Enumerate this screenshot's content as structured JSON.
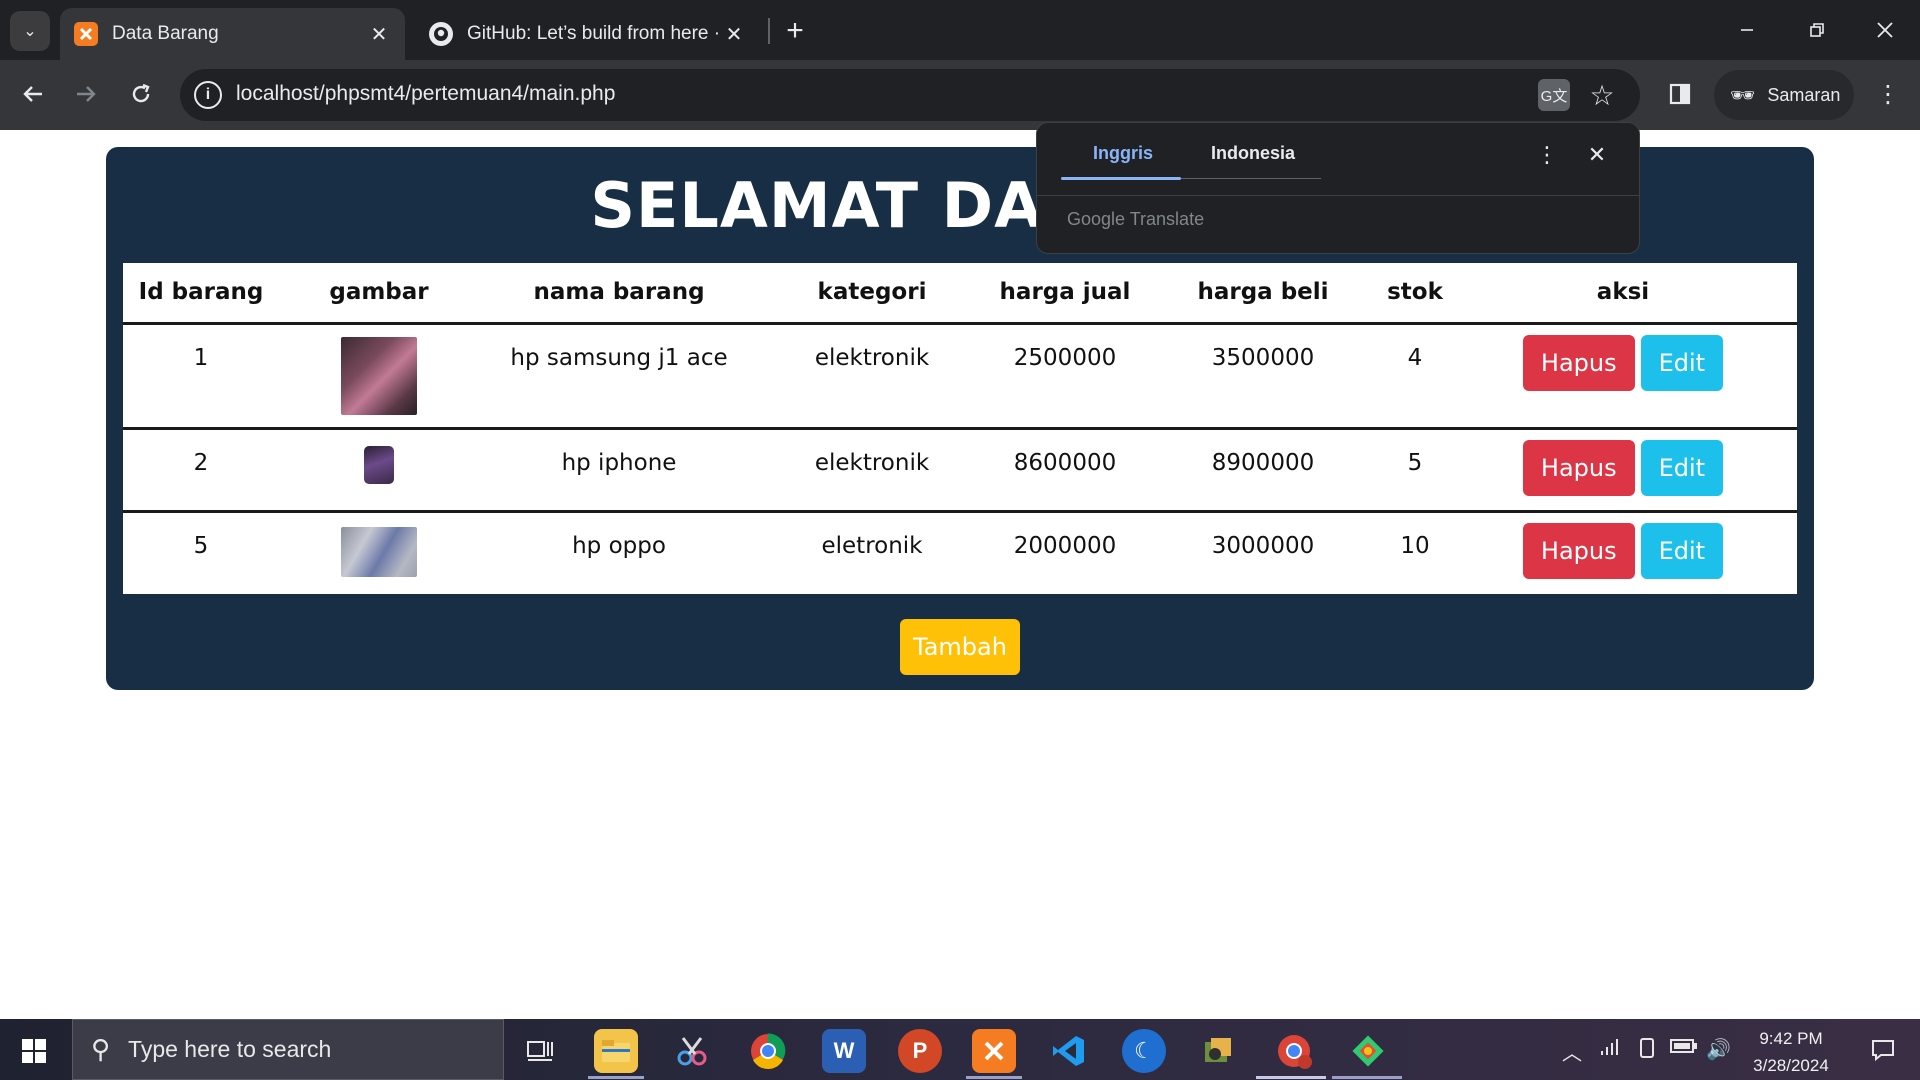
{
  "browser": {
    "tabs": [
      {
        "title": "Data Barang",
        "favicon": "xampp-icon",
        "active": true
      },
      {
        "title": "GitHub: Let’s build from here · G",
        "favicon": "github-icon",
        "active": false
      }
    ],
    "url": "localhost/phpsmt4/pertemuan4/main.php",
    "profile_label": "Samaran"
  },
  "translate_popup": {
    "source_lang": "Inggris",
    "target_lang": "Indonesia",
    "provider": "Google Translate"
  },
  "page": {
    "title": "SELAMAT DATANG DI",
    "columns": [
      "Id barang",
      "gambar",
      "nama barang",
      "kategori",
      "harga jual",
      "harga beli",
      "stok",
      "aksi"
    ],
    "rows": [
      {
        "id": "1",
        "nama": "hp samsung j1 ace",
        "kategori": "elektronik",
        "harga_jual": "2500000",
        "harga_beli": "3500000",
        "stok": "4"
      },
      {
        "id": "2",
        "nama": "hp iphone",
        "kategori": "elektronik",
        "harga_jual": "8600000",
        "harga_beli": "8900000",
        "stok": "5"
      },
      {
        "id": "5",
        "nama": "hp oppo",
        "kategori": "eletronik",
        "harga_jual": "2000000",
        "harga_beli": "3000000",
        "stok": "10"
      }
    ],
    "delete_label": "Hapus",
    "edit_label": "Edit",
    "add_label": "Tambah"
  },
  "taskbar": {
    "search_placeholder": "Type here to search",
    "time": "9:42 PM",
    "date": "3/28/2024"
  },
  "colors": {
    "card_bg": "#172e45",
    "danger": "#dc3545",
    "info": "#1cc0ea",
    "warning": "#ffc107"
  }
}
